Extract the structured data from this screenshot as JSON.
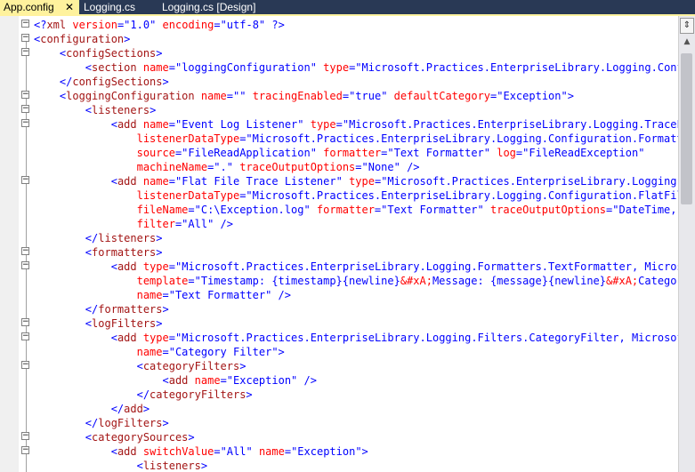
{
  "tabs": [
    {
      "label": "App.config",
      "close": "✕",
      "active": true
    },
    {
      "label": "Logging.cs",
      "active": false
    },
    {
      "label": "Logging.cs [Design]",
      "active": false
    }
  ],
  "scrollbar": {
    "split_icon": "split-icon",
    "up_icon": "chevron-up-icon"
  },
  "colors": {
    "tag": "#a31515",
    "attribute": "#ff0000",
    "value": "#0000ff",
    "bracket": "#0000ff",
    "tabbar": "#293955",
    "active_tab": "#fff29d"
  },
  "code_lines": [
    [
      [
        "b",
        "<?"
      ],
      [
        "t",
        "xml"
      ],
      [
        "p",
        " "
      ],
      [
        "a",
        "version"
      ],
      [
        "b",
        "=\""
      ],
      [
        "v",
        "1.0"
      ],
      [
        "b",
        "\" "
      ],
      [
        "a",
        "encoding"
      ],
      [
        "b",
        "=\""
      ],
      [
        "v",
        "utf-8"
      ],
      [
        "b",
        "\" ?>"
      ]
    ],
    [
      [
        "b",
        "<"
      ],
      [
        "t",
        "configuration"
      ],
      [
        "b",
        ">"
      ]
    ],
    [
      [
        "p",
        "    "
      ],
      [
        "b",
        "<"
      ],
      [
        "t",
        "configSections"
      ],
      [
        "b",
        ">"
      ]
    ],
    [
      [
        "p",
        "        "
      ],
      [
        "b",
        "<"
      ],
      [
        "t",
        "section"
      ],
      [
        "p",
        " "
      ],
      [
        "a",
        "name"
      ],
      [
        "b",
        "=\""
      ],
      [
        "v",
        "loggingConfiguration"
      ],
      [
        "b",
        "\" "
      ],
      [
        "a",
        "type"
      ],
      [
        "b",
        "=\""
      ],
      [
        "v",
        "Microsoft.Practices.EnterpriseLibrary.Logging.Configu"
      ]
    ],
    [
      [
        "p",
        "    "
      ],
      [
        "b",
        "</"
      ],
      [
        "t",
        "configSections"
      ],
      [
        "b",
        ">"
      ]
    ],
    [
      [
        "p",
        "    "
      ],
      [
        "b",
        "<"
      ],
      [
        "t",
        "loggingConfiguration"
      ],
      [
        "p",
        " "
      ],
      [
        "a",
        "name"
      ],
      [
        "b",
        "=\"\" "
      ],
      [
        "a",
        "tracingEnabled"
      ],
      [
        "b",
        "=\""
      ],
      [
        "v",
        "true"
      ],
      [
        "b",
        "\" "
      ],
      [
        "a",
        "defaultCategory"
      ],
      [
        "b",
        "=\""
      ],
      [
        "v",
        "Exception"
      ],
      [
        "b",
        "\">"
      ]
    ],
    [
      [
        "p",
        "        "
      ],
      [
        "b",
        "<"
      ],
      [
        "t",
        "listeners"
      ],
      [
        "b",
        ">"
      ]
    ],
    [
      [
        "p",
        "            "
      ],
      [
        "b",
        "<"
      ],
      [
        "t",
        "add"
      ],
      [
        "p",
        " "
      ],
      [
        "a",
        "name"
      ],
      [
        "b",
        "=\""
      ],
      [
        "v",
        "Event Log Listener"
      ],
      [
        "b",
        "\" "
      ],
      [
        "a",
        "type"
      ],
      [
        "b",
        "=\""
      ],
      [
        "v",
        "Microsoft.Practices.EnterpriseLibrary.Logging.TraceList"
      ]
    ],
    [
      [
        "p",
        "                "
      ],
      [
        "a",
        "listenerDataType"
      ],
      [
        "b",
        "=\""
      ],
      [
        "v",
        "Microsoft.Practices.EnterpriseLibrary.Logging.Configuration.Formatted"
      ]
    ],
    [
      [
        "p",
        "                "
      ],
      [
        "a",
        "source"
      ],
      [
        "b",
        "=\""
      ],
      [
        "v",
        "FileReadApplication"
      ],
      [
        "b",
        "\" "
      ],
      [
        "a",
        "formatter"
      ],
      [
        "b",
        "=\""
      ],
      [
        "v",
        "Text Formatter"
      ],
      [
        "b",
        "\" "
      ],
      [
        "a",
        "log"
      ],
      [
        "b",
        "=\""
      ],
      [
        "v",
        "FileReadException"
      ],
      [
        "b",
        "\""
      ]
    ],
    [
      [
        "p",
        "                "
      ],
      [
        "a",
        "machineName"
      ],
      [
        "b",
        "=\""
      ],
      [
        "v",
        "."
      ],
      [
        "b",
        "\" "
      ],
      [
        "a",
        "traceOutputOptions"
      ],
      [
        "b",
        "=\""
      ],
      [
        "v",
        "None"
      ],
      [
        "b",
        "\" />"
      ]
    ],
    [
      [
        "p",
        "            "
      ],
      [
        "b",
        "<"
      ],
      [
        "t",
        "add"
      ],
      [
        "p",
        " "
      ],
      [
        "a",
        "name"
      ],
      [
        "b",
        "=\""
      ],
      [
        "v",
        "Flat File Trace Listener"
      ],
      [
        "b",
        "\" "
      ],
      [
        "a",
        "type"
      ],
      [
        "b",
        "=\""
      ],
      [
        "v",
        "Microsoft.Practices.EnterpriseLibrary.Logging.Tra"
      ]
    ],
    [
      [
        "p",
        "                "
      ],
      [
        "a",
        "listenerDataType"
      ],
      [
        "b",
        "=\""
      ],
      [
        "v",
        "Microsoft.Practices.EnterpriseLibrary.Logging.Configuration.FlatFileTr"
      ]
    ],
    [
      [
        "p",
        "                "
      ],
      [
        "a",
        "fileName"
      ],
      [
        "b",
        "=\""
      ],
      [
        "v",
        "C:\\Exception.log"
      ],
      [
        "b",
        "\" "
      ],
      [
        "a",
        "formatter"
      ],
      [
        "b",
        "=\""
      ],
      [
        "v",
        "Text Formatter"
      ],
      [
        "b",
        "\" "
      ],
      [
        "a",
        "traceOutputOptions"
      ],
      [
        "b",
        "=\""
      ],
      [
        "v",
        "DateTime, Pro"
      ]
    ],
    [
      [
        "p",
        "                "
      ],
      [
        "a",
        "filter"
      ],
      [
        "b",
        "=\""
      ],
      [
        "v",
        "All"
      ],
      [
        "b",
        "\" />"
      ]
    ],
    [
      [
        "p",
        "        "
      ],
      [
        "b",
        "</"
      ],
      [
        "t",
        "listeners"
      ],
      [
        "b",
        ">"
      ]
    ],
    [
      [
        "p",
        "        "
      ],
      [
        "b",
        "<"
      ],
      [
        "t",
        "formatters"
      ],
      [
        "b",
        ">"
      ]
    ],
    [
      [
        "p",
        "            "
      ],
      [
        "b",
        "<"
      ],
      [
        "t",
        "add"
      ],
      [
        "p",
        " "
      ],
      [
        "a",
        "type"
      ],
      [
        "b",
        "=\""
      ],
      [
        "v",
        "Microsoft.Practices.EnterpriseLibrary.Logging.Formatters.TextFormatter, Microsoft"
      ]
    ],
    [
      [
        "p",
        "                "
      ],
      [
        "a",
        "template"
      ],
      [
        "b",
        "=\""
      ],
      [
        "v",
        "Timestamp: {timestamp}{newline}"
      ],
      [
        "a",
        "&#xA;"
      ],
      [
        "v",
        "Message: {message}{newline}"
      ],
      [
        "a",
        "&#xA;"
      ],
      [
        "v",
        "Category: "
      ]
    ],
    [
      [
        "p",
        "                "
      ],
      [
        "a",
        "name"
      ],
      [
        "b",
        "=\""
      ],
      [
        "v",
        "Text Formatter"
      ],
      [
        "b",
        "\" />"
      ]
    ],
    [
      [
        "p",
        "        "
      ],
      [
        "b",
        "</"
      ],
      [
        "t",
        "formatters"
      ],
      [
        "b",
        ">"
      ]
    ],
    [
      [
        "p",
        "        "
      ],
      [
        "b",
        "<"
      ],
      [
        "t",
        "logFilters"
      ],
      [
        "b",
        ">"
      ]
    ],
    [
      [
        "p",
        "            "
      ],
      [
        "b",
        "<"
      ],
      [
        "t",
        "add"
      ],
      [
        "p",
        " "
      ],
      [
        "a",
        "type"
      ],
      [
        "b",
        "=\""
      ],
      [
        "v",
        "Microsoft.Practices.EnterpriseLibrary.Logging.Filters.CategoryFilter, Microsoft.P"
      ]
    ],
    [
      [
        "p",
        "                "
      ],
      [
        "a",
        "name"
      ],
      [
        "b",
        "=\""
      ],
      [
        "v",
        "Category Filter"
      ],
      [
        "b",
        "\">"
      ]
    ],
    [
      [
        "p",
        "                "
      ],
      [
        "b",
        "<"
      ],
      [
        "t",
        "categoryFilters"
      ],
      [
        "b",
        ">"
      ]
    ],
    [
      [
        "p",
        "                    "
      ],
      [
        "b",
        "<"
      ],
      [
        "t",
        "add"
      ],
      [
        "p",
        " "
      ],
      [
        "a",
        "name"
      ],
      [
        "b",
        "=\""
      ],
      [
        "v",
        "Exception"
      ],
      [
        "b",
        "\" />"
      ]
    ],
    [
      [
        "p",
        "                "
      ],
      [
        "b",
        "</"
      ],
      [
        "t",
        "categoryFilters"
      ],
      [
        "b",
        ">"
      ]
    ],
    [
      [
        "p",
        "            "
      ],
      [
        "b",
        "</"
      ],
      [
        "t",
        "add"
      ],
      [
        "b",
        ">"
      ]
    ],
    [
      [
        "p",
        "        "
      ],
      [
        "b",
        "</"
      ],
      [
        "t",
        "logFilters"
      ],
      [
        "b",
        ">"
      ]
    ],
    [
      [
        "p",
        "        "
      ],
      [
        "b",
        "<"
      ],
      [
        "t",
        "categorySources"
      ],
      [
        "b",
        ">"
      ]
    ],
    [
      [
        "p",
        "            "
      ],
      [
        "b",
        "<"
      ],
      [
        "t",
        "add"
      ],
      [
        "p",
        " "
      ],
      [
        "a",
        "switchValue"
      ],
      [
        "b",
        "=\""
      ],
      [
        "v",
        "All"
      ],
      [
        "b",
        "\" "
      ],
      [
        "a",
        "name"
      ],
      [
        "b",
        "=\""
      ],
      [
        "v",
        "Exception"
      ],
      [
        "b",
        "\">"
      ]
    ],
    [
      [
        "p",
        "                "
      ],
      [
        "b",
        "<"
      ],
      [
        "t",
        "listeners"
      ],
      [
        "b",
        ">"
      ]
    ]
  ],
  "fold_marks": [
    "⊟",
    "⊟",
    "−",
    "⊟",
    "⊟",
    "−",
    "−",
    "⊟",
    "⊟",
    "−",
    "⊟",
    "⊟",
    "⊟"
  ]
}
